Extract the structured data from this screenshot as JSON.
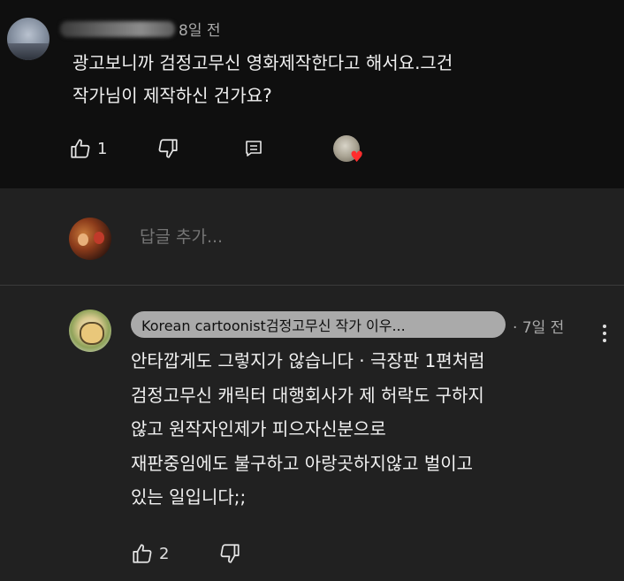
{
  "top_comment": {
    "time": "8일 전",
    "text": "광고보니까 검정고무신 영화제작한다고 해서요.그건\n작가님이 제작하신 건가요?",
    "likes": "1",
    "icons": {
      "like": "thumbs-up-icon",
      "dislike": "thumbs-down-icon",
      "reply": "reply-icon",
      "more": "more-vert-icon",
      "creator_heart": "heart-icon"
    }
  },
  "reply_box": {
    "placeholder": "답글 추가..."
  },
  "reply_comment": {
    "author": "Korean cartoonist검정고무신 작가 이우...",
    "time": "7일 전",
    "text": "안타깝게도 그렇지가 않습니다 · 극장판 1편처럼\n검정고무신 캐릭터 대행회사가 제 허락도 구하지\n않고 원작자인제가 피으자신분으로\n재판중임에도 불구하고 아랑곳하지않고 벌이고\n있는 일입니다;;",
    "likes": "2"
  },
  "colors": {
    "background_top": "#0f0f0f",
    "background_reply": "#212121",
    "text_primary": "#f1f1f1",
    "text_secondary": "#aaaaaa",
    "chip": "#aaaaaa",
    "heart": "#ff2d2d"
  }
}
